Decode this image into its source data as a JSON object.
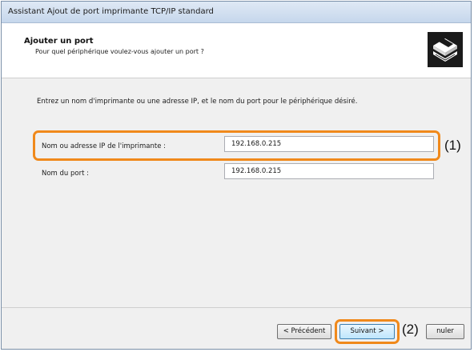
{
  "window": {
    "title": "Assistant Ajout de port imprimante TCP/IP standard"
  },
  "header": {
    "title": "Ajouter un port",
    "subtitle": "Pour quel périphérique voulez-vous ajouter un port ?",
    "icon": "printer-network-icon"
  },
  "body": {
    "instruction": "Entrez un nom d'imprimante ou une adresse IP, et le nom du port pour le périphérique désiré.",
    "fields": [
      {
        "label": "Nom ou adresse IP de l'imprimante :",
        "value": "192.168.0.215"
      },
      {
        "label": "Nom du port :",
        "value": "192.168.0.215"
      }
    ]
  },
  "callouts": {
    "one": "(1)",
    "two": "(2)"
  },
  "footer": {
    "back_label": "< Précédent",
    "next_label": "Suivant >",
    "cancel_label": "nuler"
  },
  "colors": {
    "highlight": "#f0891b",
    "titlebar": "#c6d7ec"
  }
}
